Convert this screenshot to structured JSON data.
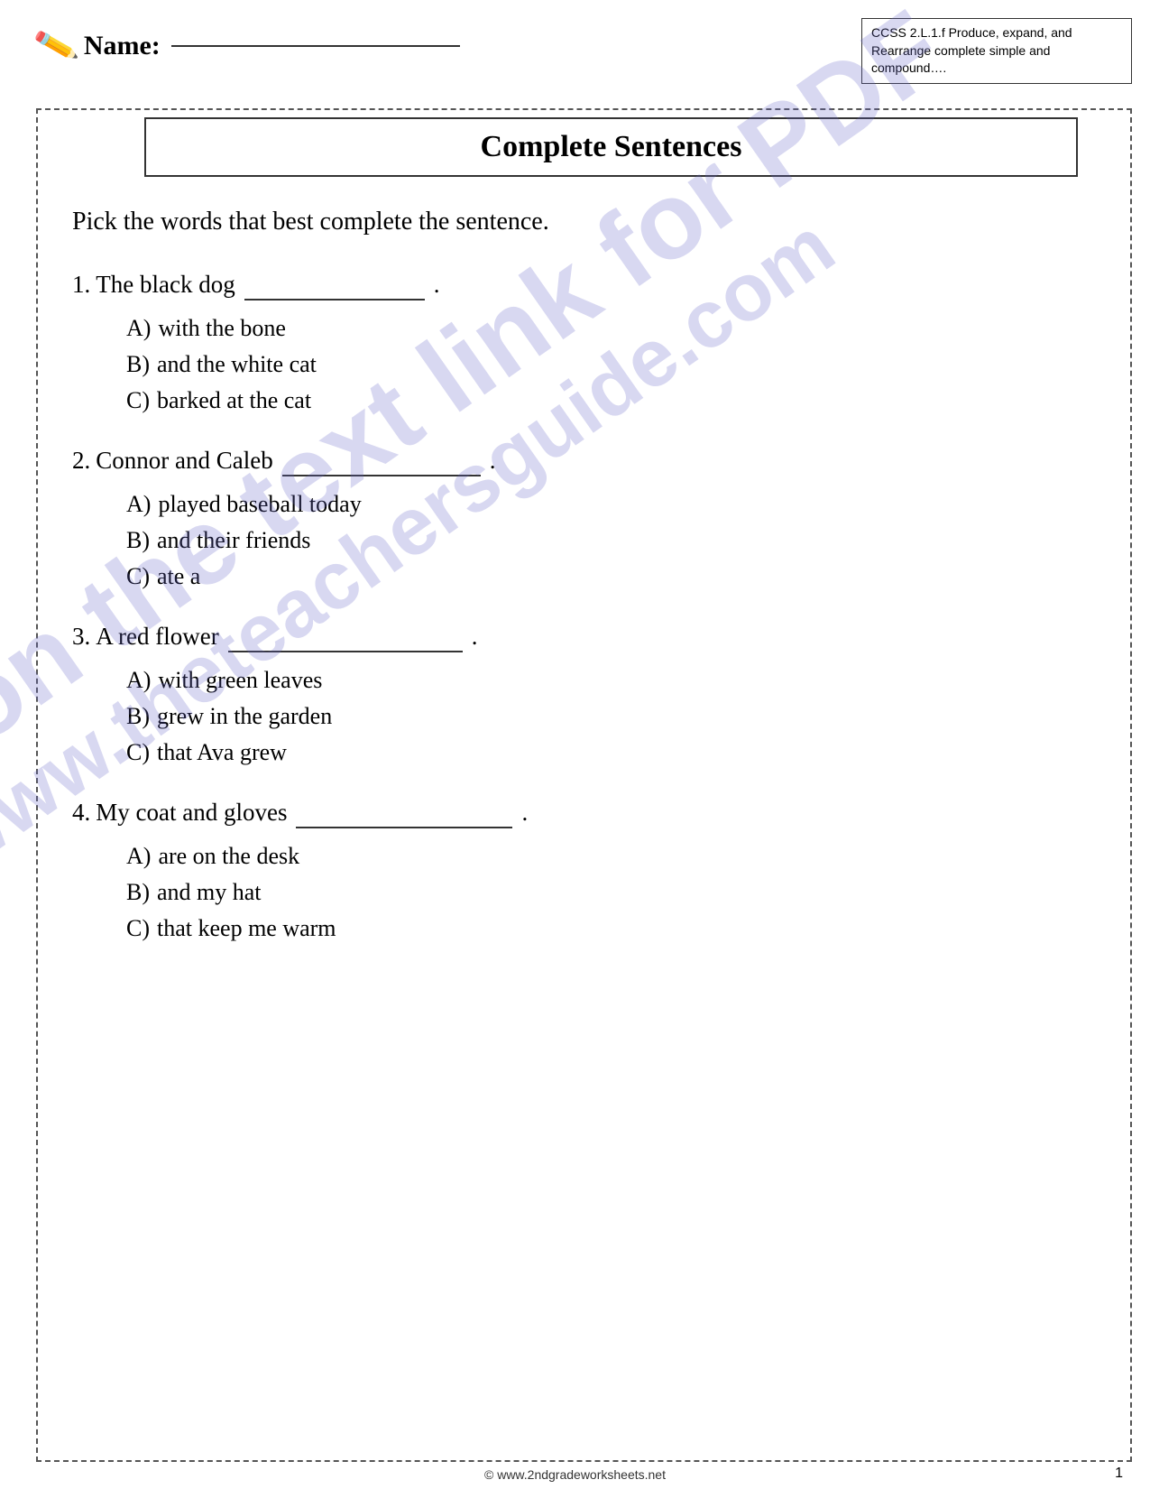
{
  "header": {
    "name_label": "Name:",
    "standard_text": "CCSS 2.L.1.f  Produce, expand, and Rearrange complete simple and compound…."
  },
  "title": "Complete Sentences",
  "instructions": "Pick the words that best complete the sentence.",
  "questions": [
    {
      "number": "1.",
      "stem_parts": [
        "The black dog",
        ""
      ],
      "blank_after": true,
      "period": ".",
      "options": [
        {
          "label": "A)",
          "text": "with the bone"
        },
        {
          "label": "B)",
          "text": "and the white cat"
        },
        {
          "label": "C)",
          "text": "barked at the cat"
        }
      ]
    },
    {
      "number": "2.",
      "stem_parts": [
        "Connor and Caleb",
        ""
      ],
      "blank_after": true,
      "period": ".",
      "options": [
        {
          "label": "A)",
          "text": "played baseball today"
        },
        {
          "label": "B)",
          "text": "and their friends"
        },
        {
          "label": "C)",
          "text": "ate a"
        }
      ]
    },
    {
      "number": "3.",
      "stem_parts": [
        "A red flower",
        ""
      ],
      "blank_after": true,
      "period": ".",
      "options": [
        {
          "label": "A)",
          "text": "with green leaves"
        },
        {
          "label": "B)",
          "text": "grew in the garden"
        },
        {
          "label": "C)",
          "text": "that Ava grew"
        }
      ]
    },
    {
      "number": "4.",
      "stem_parts": [
        "My coat and gloves",
        ""
      ],
      "blank_after": true,
      "period": ".",
      "options": [
        {
          "label": "A)",
          "text": "are on the desk"
        },
        {
          "label": "B)",
          "text": "and my hat"
        },
        {
          "label": "C)",
          "text": "that keep me warm"
        }
      ]
    }
  ],
  "watermark": {
    "line1": "Click on the text link for PDF",
    "line2": "www.theteachersguide.com"
  },
  "footer": {
    "copyright": "© www.2ndgradeworksheets.net",
    "page_number": "1"
  }
}
